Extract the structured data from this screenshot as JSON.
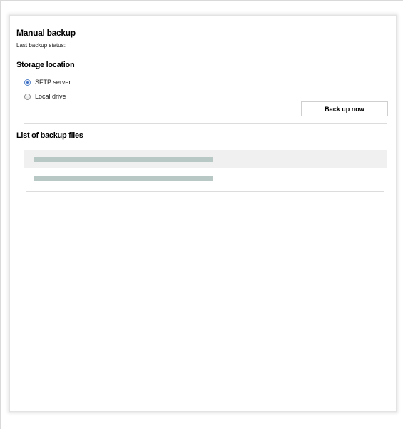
{
  "manual_backup": {
    "title": "Manual backup",
    "status_label": "Last backup status:"
  },
  "storage": {
    "title": "Storage location",
    "options": [
      {
        "label": "SFTP server",
        "selected": true
      },
      {
        "label": "Local drive",
        "selected": false
      }
    ],
    "backup_button_label": "Back up now"
  },
  "backup_files": {
    "title": "List of backup files",
    "rows": 2
  },
  "colors": {
    "placeholder_bar": "#b8c8c4",
    "row_shade": "#f0f0f0",
    "radio_accent": "#3d6fc7"
  }
}
